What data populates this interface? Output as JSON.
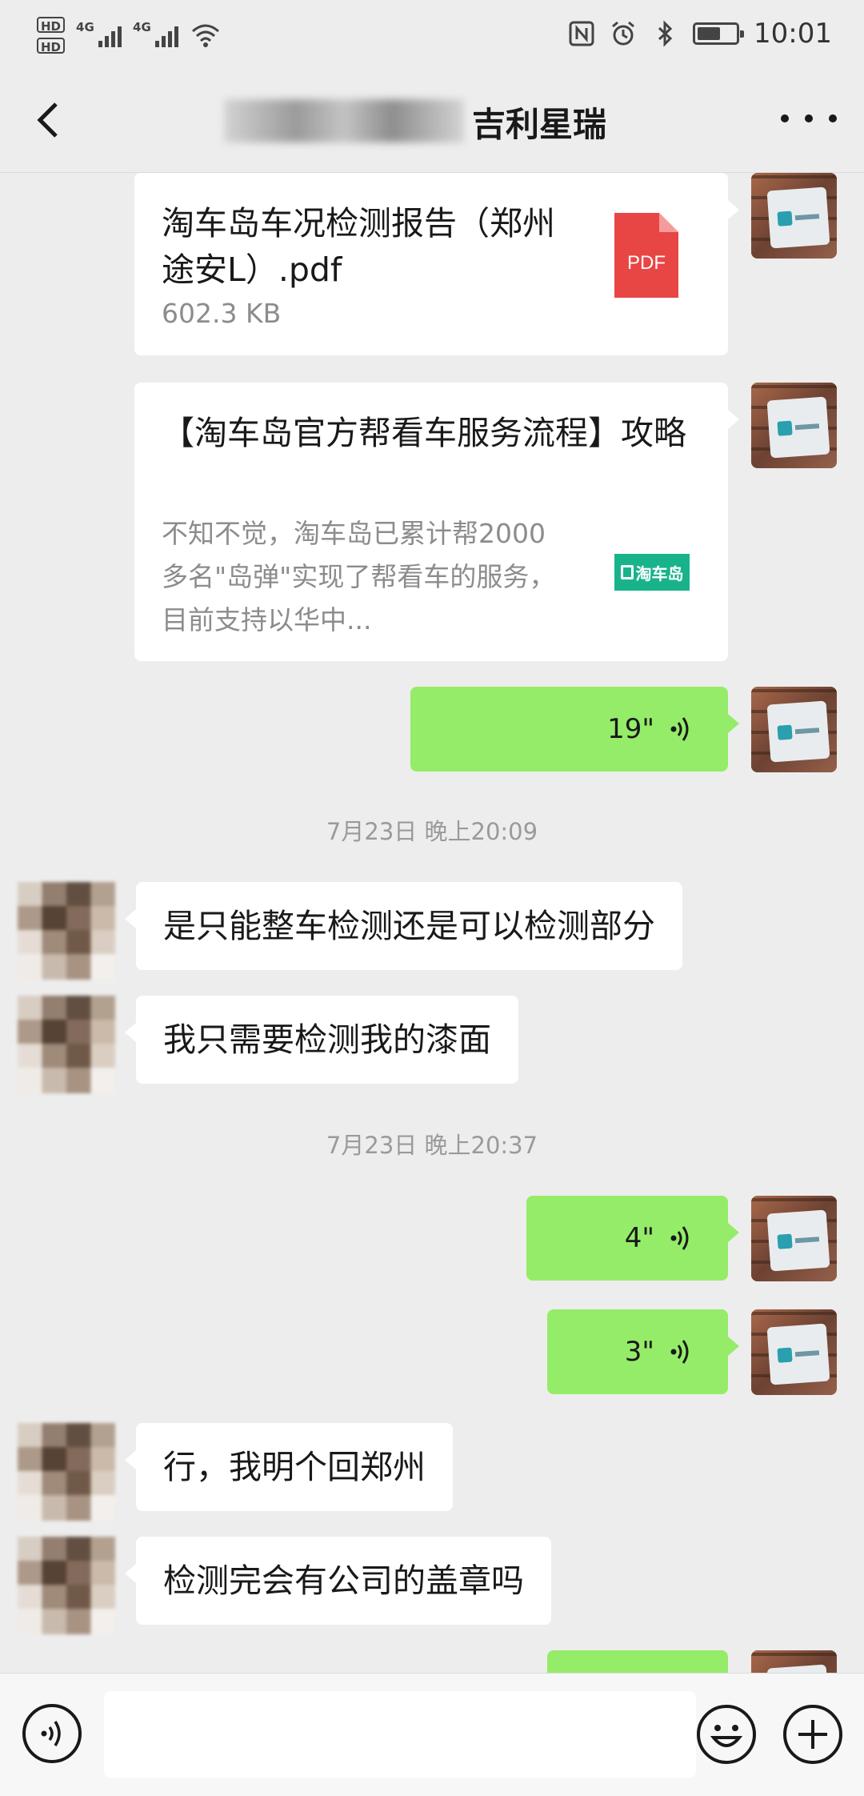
{
  "status_bar": {
    "hd1": "HD",
    "hd2": "HD",
    "sim1_label": "4G",
    "sim2_label": "4G",
    "time": "10:01",
    "battery_level": 0.6
  },
  "header": {
    "title_visible": "吉利星瑞",
    "back_icon": "chevron-left-icon",
    "more_icon": "more-dots-icon"
  },
  "messages": {
    "file_card": {
      "name": "淘车岛车况检测报告（郑州途安L）.pdf",
      "size": "602.3 KB",
      "icon_label": "PDF"
    },
    "article_card": {
      "title": "【淘车岛官方帮看车服务流程】攻略",
      "description": "不知不觉，淘车岛已累计帮2000多名\"岛弹\"实现了帮看车的服务，目前支持以华中...",
      "logo_text": "淘车岛"
    },
    "voice1": {
      "duration": "19\""
    },
    "timestamp1": "7月23日 晚上20:09",
    "text1": "是只能整车检测还是可以检测部分",
    "text2": "我只需要检测我的漆面",
    "timestamp2": "7月23日 晚上20:37",
    "voice2": {
      "duration": "4\""
    },
    "voice3": {
      "duration": "3\""
    },
    "text3": "行，我明个回郑州",
    "text4": "检测完会有公司的盖章吗"
  },
  "input_bar": {
    "voice_icon": "voice-input-icon",
    "emoji_icon": "emoji-icon",
    "plus_icon": "plus-icon"
  },
  "colors": {
    "background": "#ededed",
    "bubble_green": "#95ec69",
    "bubble_white": "#ffffff",
    "pdf_red": "#e84545",
    "brand_teal": "#19b38b"
  }
}
